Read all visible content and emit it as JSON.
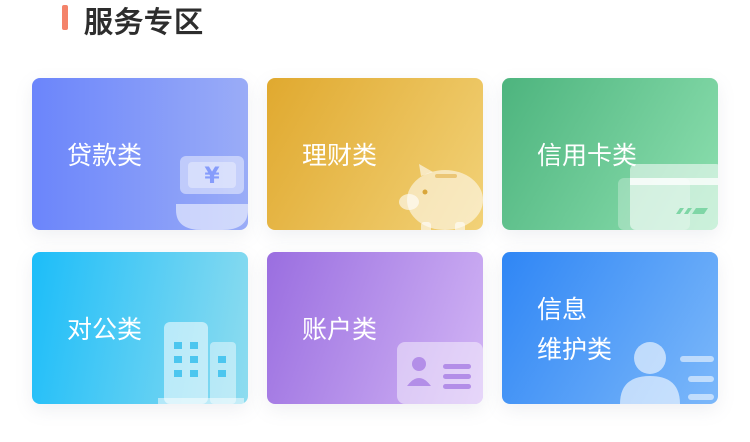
{
  "section": {
    "title": "服务专区"
  },
  "services": [
    {
      "label": "贷款类"
    },
    {
      "label": "理财类"
    },
    {
      "label": "信用卡类"
    },
    {
      "label": "对公类"
    },
    {
      "label": "账户类"
    },
    {
      "label_lines": [
        "信息",
        "维护类"
      ]
    }
  ],
  "icons": {
    "loan": "yuan-hand-icon",
    "finance": "piggy-bank-icon",
    "credit": "credit-card-icon",
    "corporate": "building-icon",
    "account": "id-card-icon",
    "info": "user-profile-icon"
  },
  "colors": {
    "accent_bar": "#f4836a",
    "title": "#2d2d2d",
    "loan": "#6b85fb",
    "finance": "#e0a92f",
    "credit": "#4db47e",
    "corporate": "#1cbdf9",
    "account": "#9a6ee0",
    "info": "#2f86f5"
  }
}
